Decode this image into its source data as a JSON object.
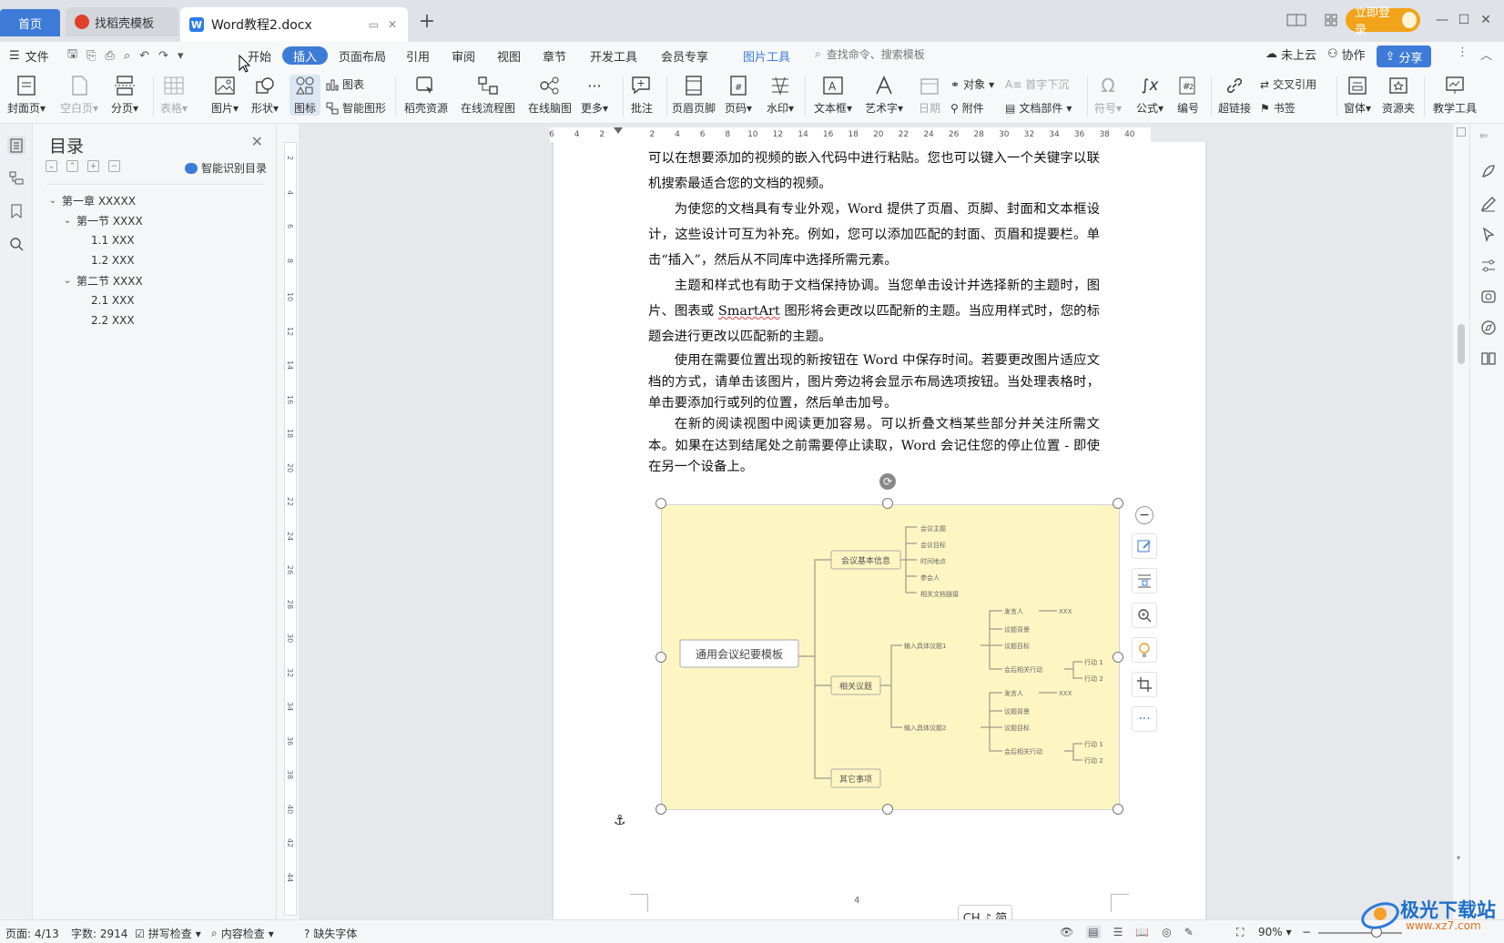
{
  "tabs": {
    "home": "首页",
    "template": "找稻壳模板",
    "doc": "Word教程2.docx"
  },
  "window": {
    "login": "立即登录"
  },
  "menu": {
    "file": "文件",
    "items": [
      "开始",
      "插入",
      "页面布局",
      "引用",
      "审阅",
      "视图",
      "章节",
      "开发工具",
      "会员专享"
    ],
    "active": "插入",
    "picture_tools": "图片工具",
    "search_placeholder": "查找命令、搜索模板",
    "cloud": "未上云",
    "collab": "协作",
    "share": "分享"
  },
  "ribbon": {
    "cover": "封面页",
    "blank": "空白页",
    "pagebreak": "分页",
    "table": "表格",
    "picture": "图片",
    "shape": "形状",
    "icon": "图标",
    "chart": "图表",
    "smart": "智能图形",
    "daoke": "稻壳资源",
    "flow": "在线流程图",
    "mind": "在线脑图",
    "more": "更多",
    "comment": "批注",
    "header": "页眉页脚",
    "pagenum": "页码",
    "watermark": "水印",
    "textbox": "文本框",
    "art": "艺术字",
    "date": "日期",
    "object": "对象",
    "attach": "附件",
    "dropcap": "首字下沉",
    "docpart": "文档部件",
    "symbol": "符号",
    "formula": "公式",
    "number": "编号",
    "link": "超链接",
    "crossref": "交叉引用",
    "bookmark": "书签",
    "window": "窗体",
    "resource": "资源夹",
    "teach": "教学工具"
  },
  "toc": {
    "title": "目录",
    "smart": "智能识别目录",
    "items": [
      {
        "label": "第一章 XXXXX",
        "level": 0
      },
      {
        "label": "第一节 XXXX",
        "level": 1
      },
      {
        "label": "1.1 XXX",
        "level": 2
      },
      {
        "label": "1.2 XXX",
        "level": 2
      },
      {
        "label": "第二节 XXXX",
        "level": 1
      },
      {
        "label": "2.1 XXX",
        "level": 2
      },
      {
        "label": "2.2 XXX",
        "level": 2
      }
    ]
  },
  "ruler": {
    "h": [
      "6",
      "4",
      "2",
      "",
      "2",
      "4",
      "6",
      "8",
      "10",
      "12",
      "14",
      "16",
      "18",
      "20",
      "22",
      "24",
      "26",
      "28",
      "30",
      "32",
      "34",
      "36",
      "38",
      "40"
    ],
    "v": [
      "2",
      "4",
      "6",
      "8",
      "10",
      "12",
      "14",
      "16",
      "18",
      "20",
      "22",
      "24",
      "26",
      "28",
      "30",
      "32",
      "34",
      "36",
      "38",
      "40",
      "42",
      "44"
    ]
  },
  "doc": {
    "p1": "可以在想要添加的视频的嵌入代码中进行粘贴。您也可以键入一个关键字以联机搜索最适合您的文档的视频。",
    "p2": "为使您的文档具有专业外观，Word 提供了页眉、页脚、封面和文本框设计，这些设计可互为补充。例如，您可以添加匹配的封面、页眉和提要栏。单击“插入”，然后从不同库中选择所需元素。",
    "p3a": "主题和样式也有助于文档保持协调。当您单击设计并选择新的主题时，图片、图表或 ",
    "p3b": "SmartArt",
    "p3c": " 图形将会更改以匹配新的主题。当应用样式时，您的标题会进行更改以匹配新的主题。",
    "p4": "使用在需要位置出现的新按钮在 Word 中保存时间。若要更改图片适应文档的方式，请单击该图片，图片旁边将会显示布局选项按钮。当处理表格时，单击要添加行或列的位置，然后单击加号。",
    "p5": "在新的阅读视图中阅读更加容易。可以折叠文档某些部分并关注所需文本。如果在达到结尾处之前需要停止读取，Word 会记住您的停止位置 - 即使在另一个设备上。",
    "page_number": "4"
  },
  "mindmap": {
    "root": "通用会议纪要模板",
    "b1": "会议基本信息",
    "b1_items": [
      "会议主题",
      "会议目标",
      "时间地点",
      "参会人",
      "相关文档链接"
    ],
    "b2": "相关议题",
    "topic1": "输入具体议题1",
    "topic2": "输入具体议题2",
    "speaker": "发言人",
    "speaker_val": "XXX",
    "bg": "议题背景",
    "goal": "议题目标",
    "action": "会后相关行动",
    "act1": "行动 1",
    "act2": "行动 2",
    "b3": "其它事项"
  },
  "ime": "CH ♪ 简",
  "status": {
    "page": "页面: 4/13",
    "words": "字数: 2914",
    "spell": "拼写检查",
    "content": "内容检查",
    "missing_font": "缺失字体",
    "zoom": "90%"
  },
  "watermark": {
    "text": "极光下载站",
    "url": "www.xz7.com"
  }
}
